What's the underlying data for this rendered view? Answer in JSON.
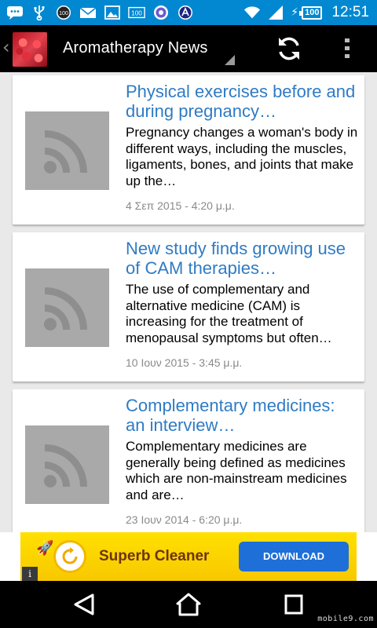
{
  "status_bar": {
    "time": "12:51",
    "battery": "100",
    "badge_1": "100",
    "badge_2": "100",
    "icons": [
      "chat-bubble-icon",
      "usb-icon",
      "counter-icon",
      "mail-icon",
      "image-icon",
      "counter-icon",
      "vpn-icon",
      "app-icon",
      "wifi-icon",
      "signal-icon",
      "charging-icon",
      "battery-icon"
    ]
  },
  "action_bar": {
    "title": "Aromatherapy News",
    "back_glyph": "‹",
    "icons": [
      "refresh-icon",
      "overflow-menu-icon"
    ]
  },
  "feed": {
    "items": [
      {
        "title": "Physical exercises before and during pregnancy…",
        "summary": "Pregnancy changes a woman's body in different ways, including the muscles, ligaments, bones, and joints that make up the…",
        "date": "4 Σεπ 2015 - 4:20 μ.μ."
      },
      {
        "title": "New study finds growing use of CAM therapies…",
        "summary": "The use of complementary and alternative medicine (CAM) is increasing for the treatment of menopausal symptoms but often…",
        "date": "10 Ιουν 2015 - 3:45 μ.μ."
      },
      {
        "title": "Complementary medicines: an interview…",
        "summary": "Complementary medicines are generally being defined as medicines which are non-mainstream medicines and are…",
        "date": "23 Ιουν 2014 - 6:20 μ.μ."
      }
    ],
    "thumbnail_icon": "rss-feed-icon"
  },
  "ad": {
    "text": "Superb Cleaner",
    "button": "DOWNLOAD",
    "info": "i",
    "colors": {
      "background": "#ffd900",
      "button": "#1e6fd8"
    }
  },
  "nav_bar": {
    "icons": [
      "back-icon",
      "home-icon",
      "recents-icon"
    ],
    "watermark": "mobile9.com"
  },
  "colors": {
    "status_bar": "#0288d1",
    "action_bar": "#000000",
    "title_link": "#2f7bc4",
    "date_text": "#8a8a8a",
    "background": "#e9e9e9"
  }
}
